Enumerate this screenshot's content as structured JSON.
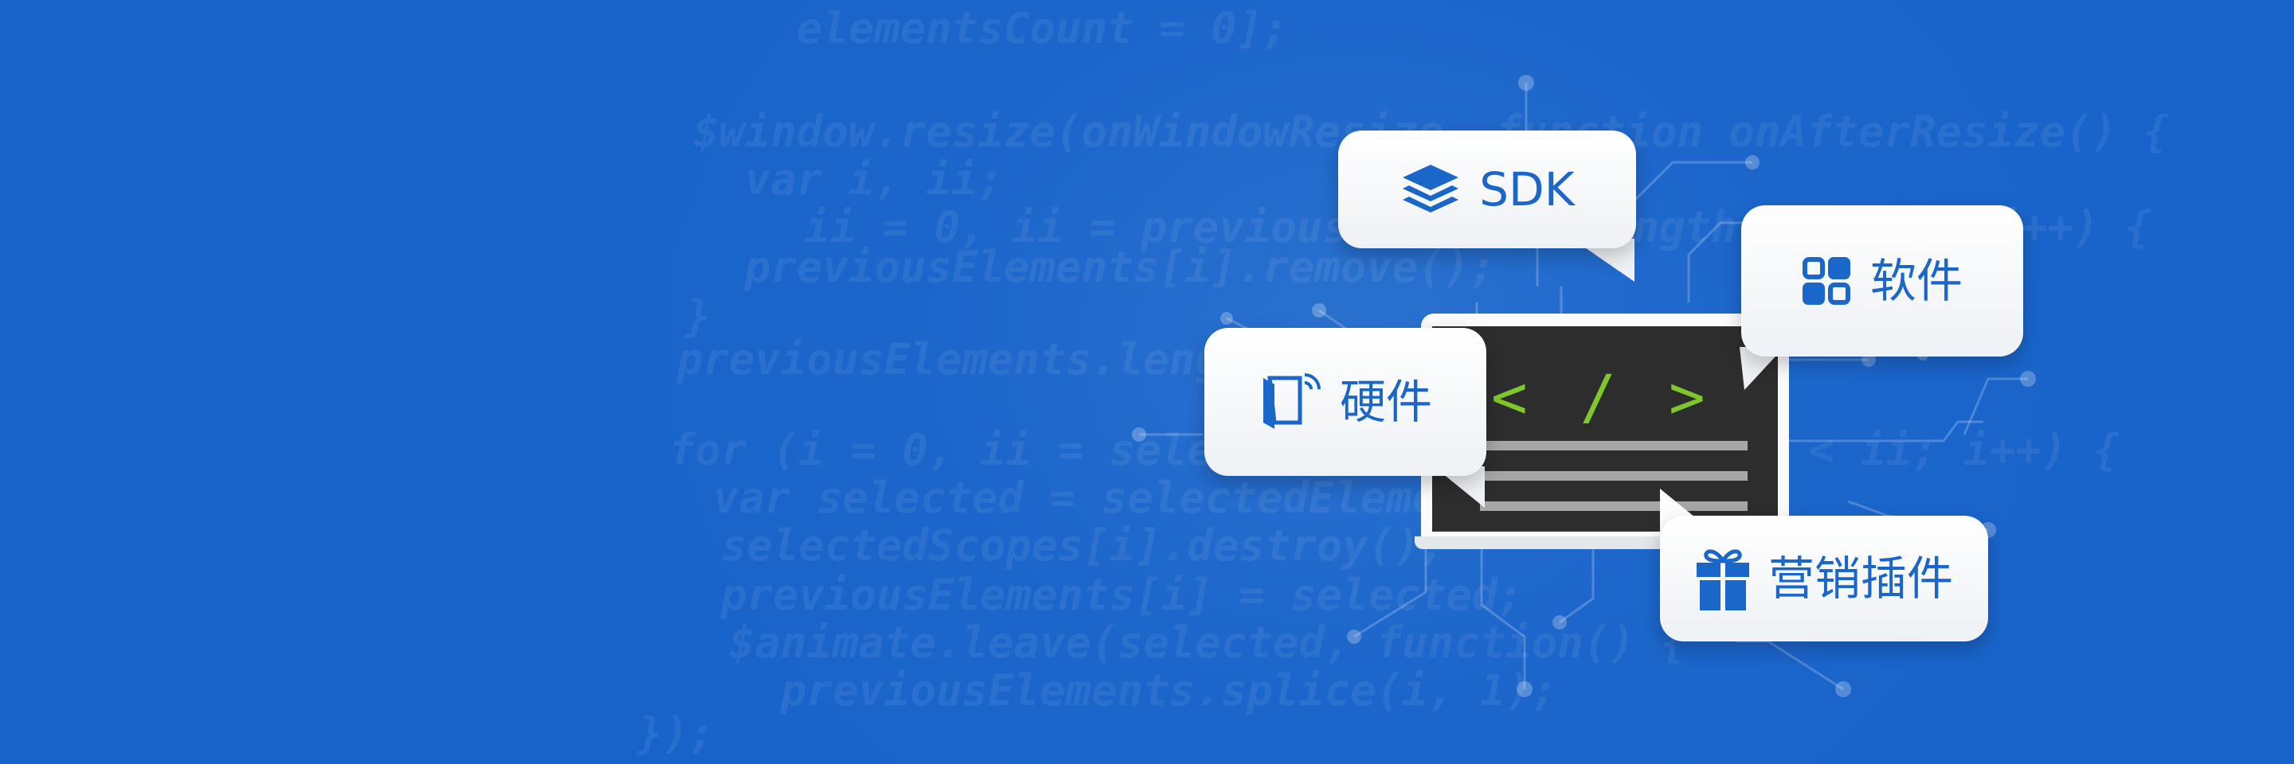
{
  "banner": {
    "background_color": "#1763ca",
    "code_lines": [
      "elementsCount = 0];",
      "$window.resize(onWindowResize, function onAfterResize() {",
      "  var i, ii;",
      "    ii = 0, ii = previousElements.length; i < ii; i++) {",
      "  previousElements[i].remove();",
      "}",
      "previousElements.length = 0;",
      "for (i = 0, ii = selectedElements.length; i < ii; i++) {",
      "  var selected = selectedElements[i];",
      "  selectedScopes[i].destroy();",
      "  previousElements[i] = selected;",
      "  $animate.leave(selected, function() {",
      "    previousElements.splice(i, 1);",
      "});"
    ]
  },
  "bubbles": {
    "sdk": {
      "label": "SDK",
      "icon": "layers-icon"
    },
    "software": {
      "label": "软件",
      "icon": "app-grid-icon"
    },
    "hardware": {
      "label": "硬件",
      "icon": "device-signal-icon"
    },
    "marketing": {
      "label": "营销插件",
      "icon": "gift-icon"
    }
  },
  "monitor": {
    "code_tag": "< / >",
    "tag_color": "#7fc72b"
  },
  "colors": {
    "accent": "#1a66c9",
    "bubble": "#ffffff",
    "screen": "#2d2d2d"
  }
}
